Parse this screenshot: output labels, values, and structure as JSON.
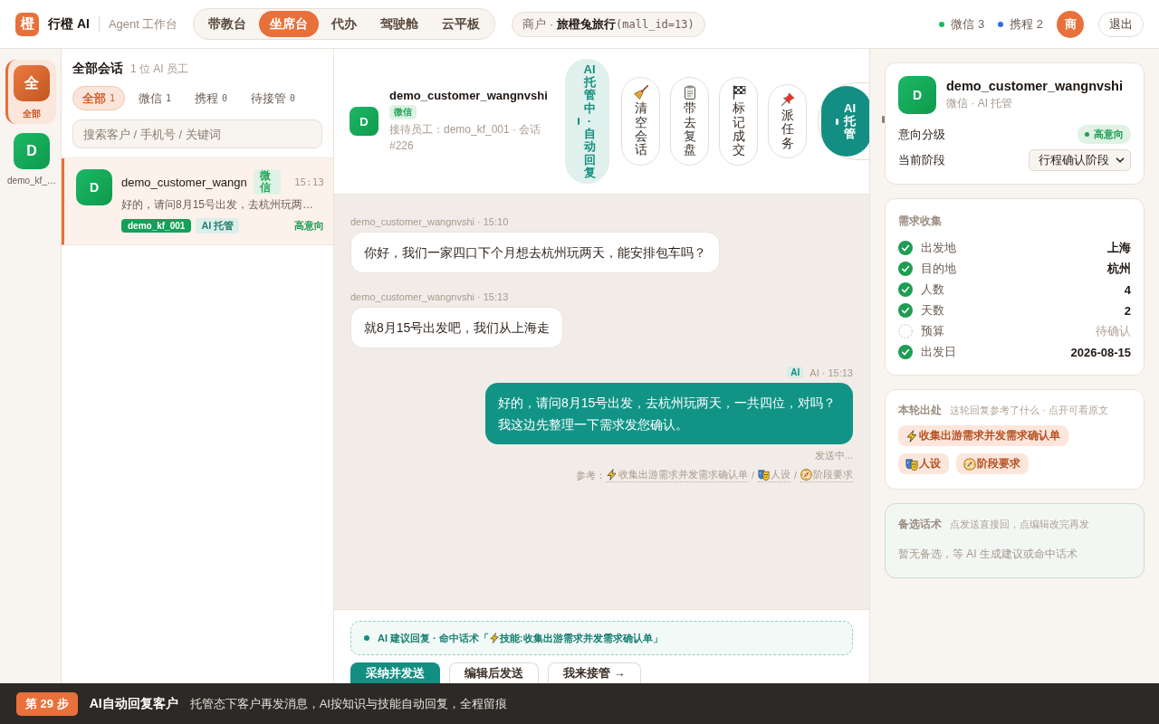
{
  "topbar": {
    "logo": "橙",
    "brand": "行橙 AI",
    "subtitle": "Agent 工作台",
    "nav": [
      {
        "label": "带教台",
        "selected": false
      },
      {
        "label": "坐席台",
        "selected": true
      },
      {
        "label": "代办",
        "selected": false
      },
      {
        "label": "驾驶舱",
        "selected": false
      },
      {
        "label": "云平板",
        "selected": false
      }
    ],
    "merchant": {
      "prefix": "商户 · ",
      "name": "旅橙兔旅行",
      "id": "(mall_id=13)"
    },
    "channels": [
      {
        "label": "微信 3",
        "color": "#1db863"
      },
      {
        "label": "携程 2",
        "color": "#2d6fe6"
      }
    ],
    "avatar": "商",
    "logout": "退出"
  },
  "rail": {
    "items": [
      {
        "kind": "all",
        "initial": "全",
        "label": "全部",
        "selected": true
      },
      {
        "kind": "agent",
        "initial": "D",
        "label": "demo_kf_…",
        "selected": false
      }
    ]
  },
  "list": {
    "title": "全部会话",
    "subtitle": "1 位 AI 员工",
    "filters": [
      {
        "label": "全部",
        "count": "1",
        "selected": true
      },
      {
        "label": "微信",
        "count": "1",
        "selected": false
      },
      {
        "label": "携程",
        "count": "0",
        "selected": false
      },
      {
        "label": "待接管",
        "count": "0",
        "selected": false
      }
    ],
    "search": {
      "placeholder": "搜索客户 / 手机号 / 关键词"
    },
    "conversations": [
      {
        "avatar": "D",
        "name": "demo_customer_wangn",
        "channel": "微信",
        "time": "15:13",
        "preview": "好的，请问8月15号出发，去杭州玩两…",
        "agent": "demo_kf_001",
        "mode": "AI 托管",
        "intent": "高意向",
        "selected": true
      }
    ]
  },
  "chat": {
    "header": {
      "avatar": "D",
      "name": "demo_customer_wangnvshi",
      "channel": "微信",
      "meta": "接待员工：demo_kf_001 · 会话 #226",
      "status": "AI 托管中 · 自动回复",
      "actions": [
        {
          "kind": "clear",
          "label": "清空会话"
        },
        {
          "kind": "review",
          "label": "带去复盘"
        },
        {
          "kind": "deal",
          "label": "标记成交"
        },
        {
          "kind": "assign",
          "label": "派任务"
        }
      ],
      "modes": [
        {
          "label": "AI 托管",
          "selected": true
        }
      ]
    },
    "messages": [
      {
        "kind": "customer",
        "author": "demo_customer_wangnvshi · 15:10",
        "text": "你好，我们一家四口下个月想去杭州玩两天，能安排包车吗？"
      },
      {
        "kind": "customer",
        "author": "demo_customer_wangnvshi · 15:13",
        "text": "就8月15号出发吧，我们从上海走"
      },
      {
        "kind": "ai",
        "badge": "AI",
        "author": "AI · 15:13",
        "text": "好的，请问8月15号出发，去杭州玩两天，一共四位，对吗？我这边先整理一下需求发您确认。",
        "status": "发送中...",
        "refs_label": "参考：",
        "separator": "/",
        "refs": [
          {
            "kind": "skill",
            "label": "收集出游需求并发需求确认单"
          },
          {
            "kind": "persona",
            "label": "人设"
          },
          {
            "kind": "stage",
            "label": "阶段要求"
          }
        ]
      }
    ],
    "compose": {
      "suggestion": {
        "prefix": "AI 建议回复 · 命中话术「",
        "skill": "技能:收集出游需求并发需求确认单」"
      },
      "buttons": [
        {
          "kind": "primary",
          "label": "采纳并发送"
        },
        {
          "kind": "secondary",
          "label": "编辑后发送"
        },
        {
          "kind": "secondary",
          "label": "我来接管 →"
        }
      ]
    }
  },
  "profile": {
    "avatar": "D",
    "name": "demo_customer_wangnvshi",
    "sub": "微信 · AI 托管",
    "intent_label": "意向分级",
    "intent": "高意向",
    "stage_label": "当前阶段",
    "stage": "行程确认阶段"
  },
  "requirements": {
    "title": "需求收集",
    "items": [
      {
        "label": "出发地",
        "value": "上海",
        "checked": true
      },
      {
        "label": "目的地",
        "value": "杭州",
        "checked": true
      },
      {
        "label": "人数",
        "value": "4",
        "checked": true
      },
      {
        "label": "天数",
        "value": "2",
        "checked": true
      },
      {
        "label": "预算",
        "value": "待确认",
        "checked": false
      },
      {
        "label": "出发日",
        "value": "2026-08-15",
        "checked": true
      }
    ]
  },
  "sources": {
    "title": "本轮出处",
    "hint": "这轮回复参考了什么 · 点开可看原文",
    "items": [
      {
        "kind": "skill",
        "label": "收集出游需求并发需求确认单"
      },
      {
        "kind": "persona",
        "label": "人设"
      },
      {
        "kind": "stage",
        "label": "阶段要求"
      }
    ]
  },
  "alternatives": {
    "title": "备选话术",
    "hint": "点发送直接回，点编辑改完再发",
    "empty": "暂无备选，等 AI 生成建议或命中话术"
  },
  "tour": {
    "step": "第 29 步",
    "title": "AI自动回复客户",
    "text": "托管态下客户再发消息，AI按知识与技能自动回复，全程留痕"
  }
}
